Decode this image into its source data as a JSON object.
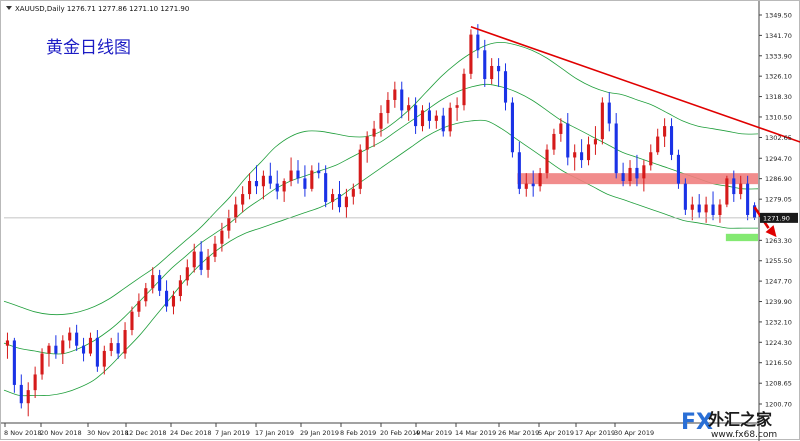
{
  "header": {
    "symbol_text": "XAUUSD,Daily  1276.71 1277.86 1271.10 1271.90"
  },
  "annotation": "黄金日线图",
  "current_price_label": "1271.90",
  "watermark": {
    "fx": "FX",
    "brand": "外汇之家",
    "url": "www.fx68.com"
  },
  "colors": {
    "bull": "#d51a1a",
    "bear": "#1a32e6",
    "band": "#1f9e3b",
    "trend": "#e00000",
    "resistance": "#f08080",
    "support": "#7de86a",
    "arrow": "#e00000"
  },
  "chart_data": {
    "type": "candlestick",
    "title": "XAUUSD,Daily",
    "ylim": [
      1200.7,
      1349.5
    ],
    "y_ticks": [
      "1349.50",
      "1341.70",
      "1333.90",
      "1326.10",
      "1318.30",
      "1310.50",
      "1302.65",
      "1294.70",
      "1286.90",
      "1279.05",
      "1271.25",
      "1263.30",
      "1255.50",
      "1247.70",
      "1239.90",
      "1232.10",
      "1224.30",
      "1216.50",
      "1208.65",
      "1200.70"
    ],
    "x_labels": [
      "8 Nov 2018",
      "20 Nov 2018",
      "30 Nov 2018",
      "12 Dec 2018",
      "24 Dec 2018",
      "7 Jan 2019",
      "17 Jan 2019",
      "29 Jan 2019",
      "8 Feb 2019",
      "20 Feb 2019",
      "4 Mar 2019",
      "14 Mar 2019",
      "26 Mar 2019",
      "5 Apr 2019",
      "17 Apr 2019",
      "30 Apr 2019"
    ],
    "last_price": 1271.9,
    "candles": [
      [
        1223,
        1228,
        1218,
        1225
      ],
      [
        1225,
        1226,
        1205,
        1208
      ],
      [
        1208,
        1212,
        1199,
        1201
      ],
      [
        1201,
        1209,
        1196,
        1206
      ],
      [
        1206,
        1215,
        1203,
        1212
      ],
      [
        1212,
        1222,
        1210,
        1220
      ],
      [
        1220,
        1224,
        1215,
        1223
      ],
      [
        1223,
        1227,
        1218,
        1220
      ],
      [
        1220,
        1227,
        1216,
        1225
      ],
      [
        1225,
        1230,
        1222,
        1228
      ],
      [
        1228,
        1231,
        1221,
        1223
      ],
      [
        1223,
        1226,
        1217,
        1220
      ],
      [
        1220,
        1228,
        1219,
        1226
      ],
      [
        1226,
        1229,
        1213,
        1215
      ],
      [
        1215,
        1223,
        1212,
        1221
      ],
      [
        1221,
        1226,
        1219,
        1224
      ],
      [
        1224,
        1228,
        1218,
        1220
      ],
      [
        1220,
        1232,
        1218,
        1229
      ],
      [
        1229,
        1238,
        1227,
        1236
      ],
      [
        1236,
        1243,
        1234,
        1240
      ],
      [
        1240,
        1247,
        1238,
        1245
      ],
      [
        1245,
        1253,
        1243,
        1250
      ],
      [
        1250,
        1252,
        1242,
        1244
      ],
      [
        1244,
        1248,
        1236,
        1238
      ],
      [
        1238,
        1244,
        1235,
        1242
      ],
      [
        1242,
        1250,
        1240,
        1248
      ],
      [
        1248,
        1256,
        1246,
        1253
      ],
      [
        1253,
        1262,
        1251,
        1259
      ],
      [
        1259,
        1263,
        1250,
        1252
      ],
      [
        1252,
        1260,
        1249,
        1257
      ],
      [
        1257,
        1265,
        1255,
        1262
      ],
      [
        1262,
        1270,
        1259,
        1267
      ],
      [
        1267,
        1275,
        1264,
        1272
      ],
      [
        1272,
        1280,
        1270,
        1277
      ],
      [
        1277,
        1284,
        1274,
        1281
      ],
      [
        1281,
        1289,
        1279,
        1286
      ],
      [
        1286,
        1292,
        1281,
        1284
      ],
      [
        1284,
        1290,
        1279,
        1288
      ],
      [
        1288,
        1293,
        1283,
        1285
      ],
      [
        1285,
        1290,
        1279,
        1282
      ],
      [
        1282,
        1287,
        1278,
        1286
      ],
      [
        1286,
        1295,
        1284,
        1290
      ],
      [
        1290,
        1294,
        1285,
        1287
      ],
      [
        1287,
        1292,
        1280,
        1283
      ],
      [
        1283,
        1292,
        1282,
        1290
      ],
      [
        1290,
        1293,
        1287,
        1289
      ],
      [
        1289,
        1292,
        1276,
        1278
      ],
      [
        1278,
        1283,
        1275,
        1281
      ],
      [
        1281,
        1286,
        1274,
        1276
      ],
      [
        1276,
        1283,
        1272,
        1280
      ],
      [
        1280,
        1285,
        1277,
        1283
      ],
      [
        1283,
        1300,
        1281,
        1298
      ],
      [
        1298,
        1305,
        1293,
        1303
      ],
      [
        1303,
        1309,
        1299,
        1306
      ],
      [
        1306,
        1315,
        1303,
        1312
      ],
      [
        1312,
        1320,
        1308,
        1317
      ],
      [
        1317,
        1324,
        1314,
        1321
      ],
      [
        1321,
        1324,
        1310,
        1313
      ],
      [
        1313,
        1318,
        1309,
        1315
      ],
      [
        1315,
        1318,
        1304,
        1307
      ],
      [
        1307,
        1315,
        1305,
        1313
      ],
      [
        1313,
        1316,
        1306,
        1309
      ],
      [
        1309,
        1313,
        1306,
        1311
      ],
      [
        1311,
        1314,
        1303,
        1305
      ],
      [
        1305,
        1316,
        1303,
        1314
      ],
      [
        1314,
        1318,
        1309,
        1315
      ],
      [
        1315,
        1329,
        1313,
        1327
      ],
      [
        1327,
        1344,
        1325,
        1342
      ],
      [
        1342,
        1346,
        1333,
        1336
      ],
      [
        1336,
        1340,
        1322,
        1325
      ],
      [
        1325,
        1333,
        1323,
        1330
      ],
      [
        1330,
        1333,
        1322,
        1328
      ],
      [
        1328,
        1331,
        1313,
        1316
      ],
      [
        1316,
        1318,
        1295,
        1297
      ],
      [
        1297,
        1301,
        1281,
        1283
      ],
      [
        1283,
        1289,
        1280,
        1285
      ],
      [
        1285,
        1290,
        1280,
        1284
      ],
      [
        1284,
        1291,
        1282,
        1289
      ],
      [
        1289,
        1300,
        1287,
        1298
      ],
      [
        1298,
        1306,
        1296,
        1304
      ],
      [
        1304,
        1310,
        1301,
        1308
      ],
      [
        1308,
        1312,
        1292,
        1295
      ],
      [
        1295,
        1300,
        1290,
        1297
      ],
      [
        1297,
        1302,
        1291,
        1294
      ],
      [
        1294,
        1303,
        1292,
        1300
      ],
      [
        1300,
        1307,
        1296,
        1302
      ],
      [
        1302,
        1318,
        1300,
        1316
      ],
      [
        1316,
        1320,
        1305,
        1308
      ],
      [
        1308,
        1312,
        1287,
        1289
      ],
      [
        1289,
        1293,
        1284,
        1286
      ],
      [
        1286,
        1294,
        1284,
        1291
      ],
      [
        1291,
        1296,
        1284,
        1287
      ],
      [
        1287,
        1294,
        1282,
        1292
      ],
      [
        1292,
        1300,
        1290,
        1297
      ],
      [
        1297,
        1306,
        1296,
        1303
      ],
      [
        1303,
        1310,
        1299,
        1307
      ],
      [
        1307,
        1310,
        1294,
        1296
      ],
      [
        1296,
        1298,
        1283,
        1285
      ],
      [
        1285,
        1287,
        1273,
        1275
      ],
      [
        1275,
        1280,
        1271,
        1277
      ],
      [
        1277,
        1281,
        1272,
        1274
      ],
      [
        1274,
        1280,
        1270,
        1277
      ],
      [
        1277,
        1282,
        1271,
        1273
      ],
      [
        1273,
        1279,
        1270,
        1277
      ],
      [
        1277,
        1288,
        1276,
        1287
      ],
      [
        1287,
        1290,
        1278,
        1281
      ],
      [
        1281,
        1288,
        1279,
        1285
      ],
      [
        1285,
        1288,
        1271,
        1273
      ],
      [
        1276.71,
        1277.86,
        1271.1,
        1271.9
      ]
    ],
    "bands": {
      "upper": [
        1240,
        1238,
        1236,
        1235,
        1235,
        1236,
        1238,
        1241,
        1245,
        1249,
        1253,
        1258,
        1263,
        1268,
        1274,
        1280,
        1287,
        1293,
        1299,
        1303,
        1305,
        1305,
        1304,
        1303,
        1303,
        1305,
        1309,
        1314,
        1320,
        1326,
        1331,
        1335,
        1338,
        1339,
        1338,
        1336,
        1333,
        1329,
        1325,
        1322,
        1320,
        1319,
        1317,
        1315,
        1312,
        1309,
        1307,
        1306,
        1305,
        1304,
        1304
      ],
      "middle": [
        1224,
        1222,
        1221,
        1220,
        1220,
        1222,
        1225,
        1229,
        1234,
        1240,
        1246,
        1252,
        1257,
        1262,
        1266,
        1270,
        1275,
        1279,
        1283,
        1286,
        1288,
        1290,
        1292,
        1295,
        1298,
        1301,
        1305,
        1309,
        1313,
        1317,
        1320,
        1322,
        1323,
        1322,
        1320,
        1317,
        1313,
        1309,
        1306,
        1303,
        1300,
        1297,
        1295,
        1293,
        1291,
        1289,
        1287,
        1285,
        1284,
        1283,
        1283
      ],
      "lower": [
        1206,
        1204,
        1204,
        1204,
        1205,
        1207,
        1210,
        1215,
        1221,
        1227,
        1234,
        1241,
        1248,
        1254,
        1259,
        1263,
        1266,
        1268,
        1270,
        1272,
        1274,
        1276,
        1279,
        1283,
        1287,
        1291,
        1295,
        1299,
        1303,
        1306,
        1308,
        1309,
        1309,
        1306,
        1302,
        1298,
        1294,
        1290,
        1287,
        1284,
        1281,
        1279,
        1277,
        1275,
        1273,
        1271,
        1270,
        1269,
        1268,
        1268,
        1268
      ]
    },
    "trendline": [
      [
        67,
        1345
      ],
      [
        155,
        1263.5
      ]
    ],
    "resistance_zone": [
      1284.8,
      1289.0
    ],
    "support_zone": [
      1263.0,
      1265.8
    ]
  }
}
